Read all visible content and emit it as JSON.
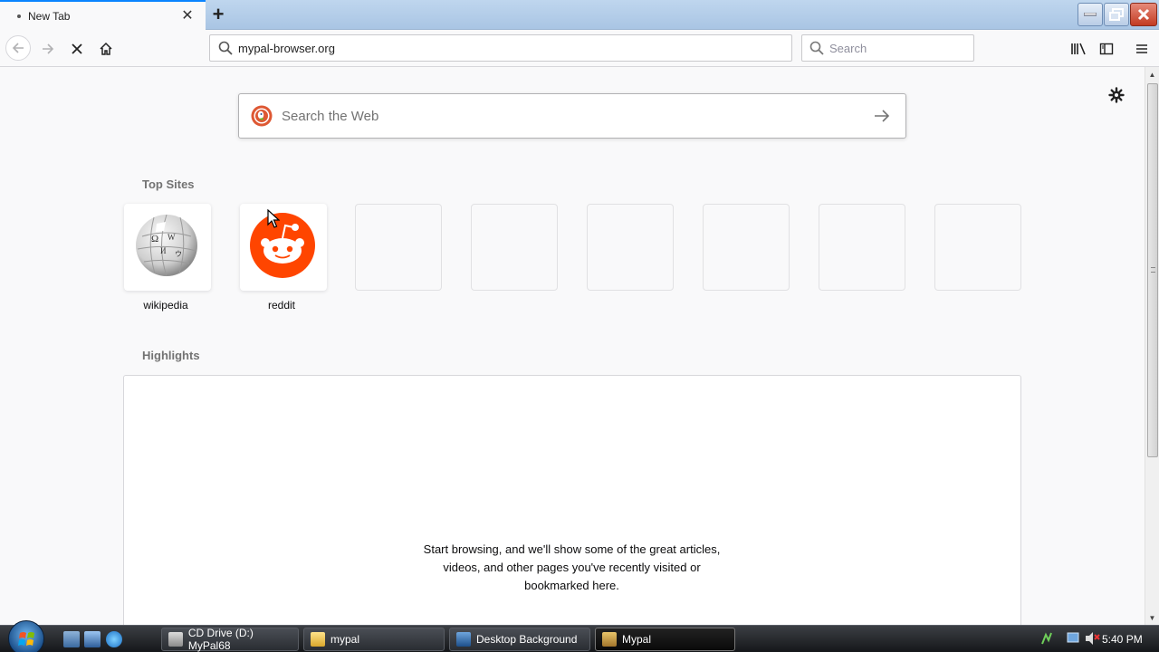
{
  "browser": {
    "tab": {
      "title": "New Tab",
      "close": "✕"
    },
    "new_tab": "+",
    "url": "mypal-browser.org",
    "search_placeholder": "Search"
  },
  "newtab_page": {
    "web_search_placeholder": "Search the Web",
    "top_sites_title": "Top Sites",
    "top_sites": [
      {
        "label": "wikipedia"
      },
      {
        "label": "reddit"
      }
    ],
    "highlights_title": "Highlights",
    "highlights_empty": [
      "Start browsing, and we'll show some of the great articles,",
      "videos, and other pages you've recently visited or",
      "bookmarked here."
    ]
  },
  "taskbar": {
    "tasks": [
      {
        "label": "CD Drive (D:) MyPal68"
      },
      {
        "label": "mypal"
      },
      {
        "label": "Desktop Background"
      },
      {
        "label": "Mypal"
      }
    ],
    "clock": "5:40 PM"
  },
  "colors": {
    "accent": "#0a84ff",
    "reddit": "#ff4500",
    "duckduckgo": "#de5833"
  }
}
